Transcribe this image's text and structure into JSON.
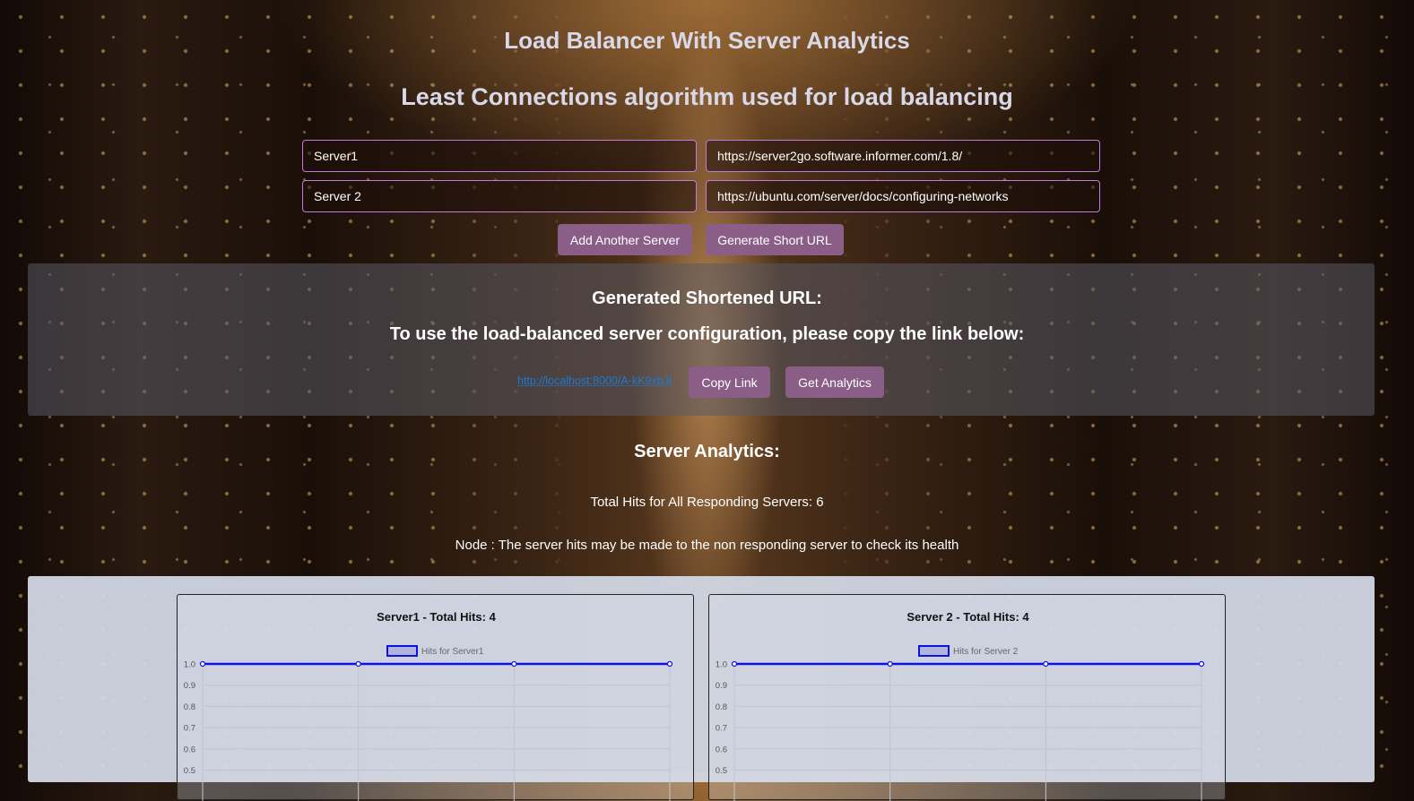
{
  "header": {
    "title": "Load Balancer With Server Analytics",
    "subtitle": "Least Connections algorithm used for load balancing"
  },
  "servers": [
    {
      "name": "Server1",
      "url": "https://server2go.software.informer.com/1.8/"
    },
    {
      "name": "Server 2",
      "url": "https://ubuntu.com/server/docs/configuring-networks"
    }
  ],
  "actions": {
    "add_server": "Add Another Server",
    "generate": "Generate Short URL"
  },
  "result": {
    "heading": "Generated Shortened URL:",
    "instruction": "To use the load-balanced server configuration, please copy the link below:",
    "short_url": "http://localhost:8000/A-kK9xbJt",
    "copy": "Copy Link",
    "analytics": "Get Analytics"
  },
  "analytics": {
    "title": "Server Analytics:",
    "total": "Total Hits for All Responding Servers: 6",
    "note": "Node : The server hits may be made to the non responding server to check its health"
  },
  "colors": {
    "accent_button": "#8a5e87",
    "input_border": "#c27bd8",
    "line": "#1010e0",
    "link": "#1e7ad0"
  },
  "chart_data": [
    {
      "type": "line",
      "title": "Server1 - Total Hits: 4",
      "series": [
        {
          "name": "Hits for Server1",
          "values": [
            1,
            1,
            1,
            1
          ]
        }
      ],
      "x": [
        "",
        "",
        "",
        ""
      ],
      "yticks": [
        "1.0",
        "0.9",
        "0.8",
        "0.7",
        "0.6",
        "0.5"
      ],
      "ylim": [
        0.5,
        1.0
      ],
      "grid": true,
      "legend": "top"
    },
    {
      "type": "line",
      "title": "Server 2 - Total Hits: 4",
      "series": [
        {
          "name": "Hits for Server 2",
          "values": [
            1,
            1,
            1,
            1
          ]
        }
      ],
      "x": [
        "",
        "",
        "",
        ""
      ],
      "yticks": [
        "1.0",
        "0.9",
        "0.8",
        "0.7",
        "0.6",
        "0.5"
      ],
      "ylim": [
        0.5,
        1.0
      ],
      "grid": true,
      "legend": "top"
    }
  ]
}
